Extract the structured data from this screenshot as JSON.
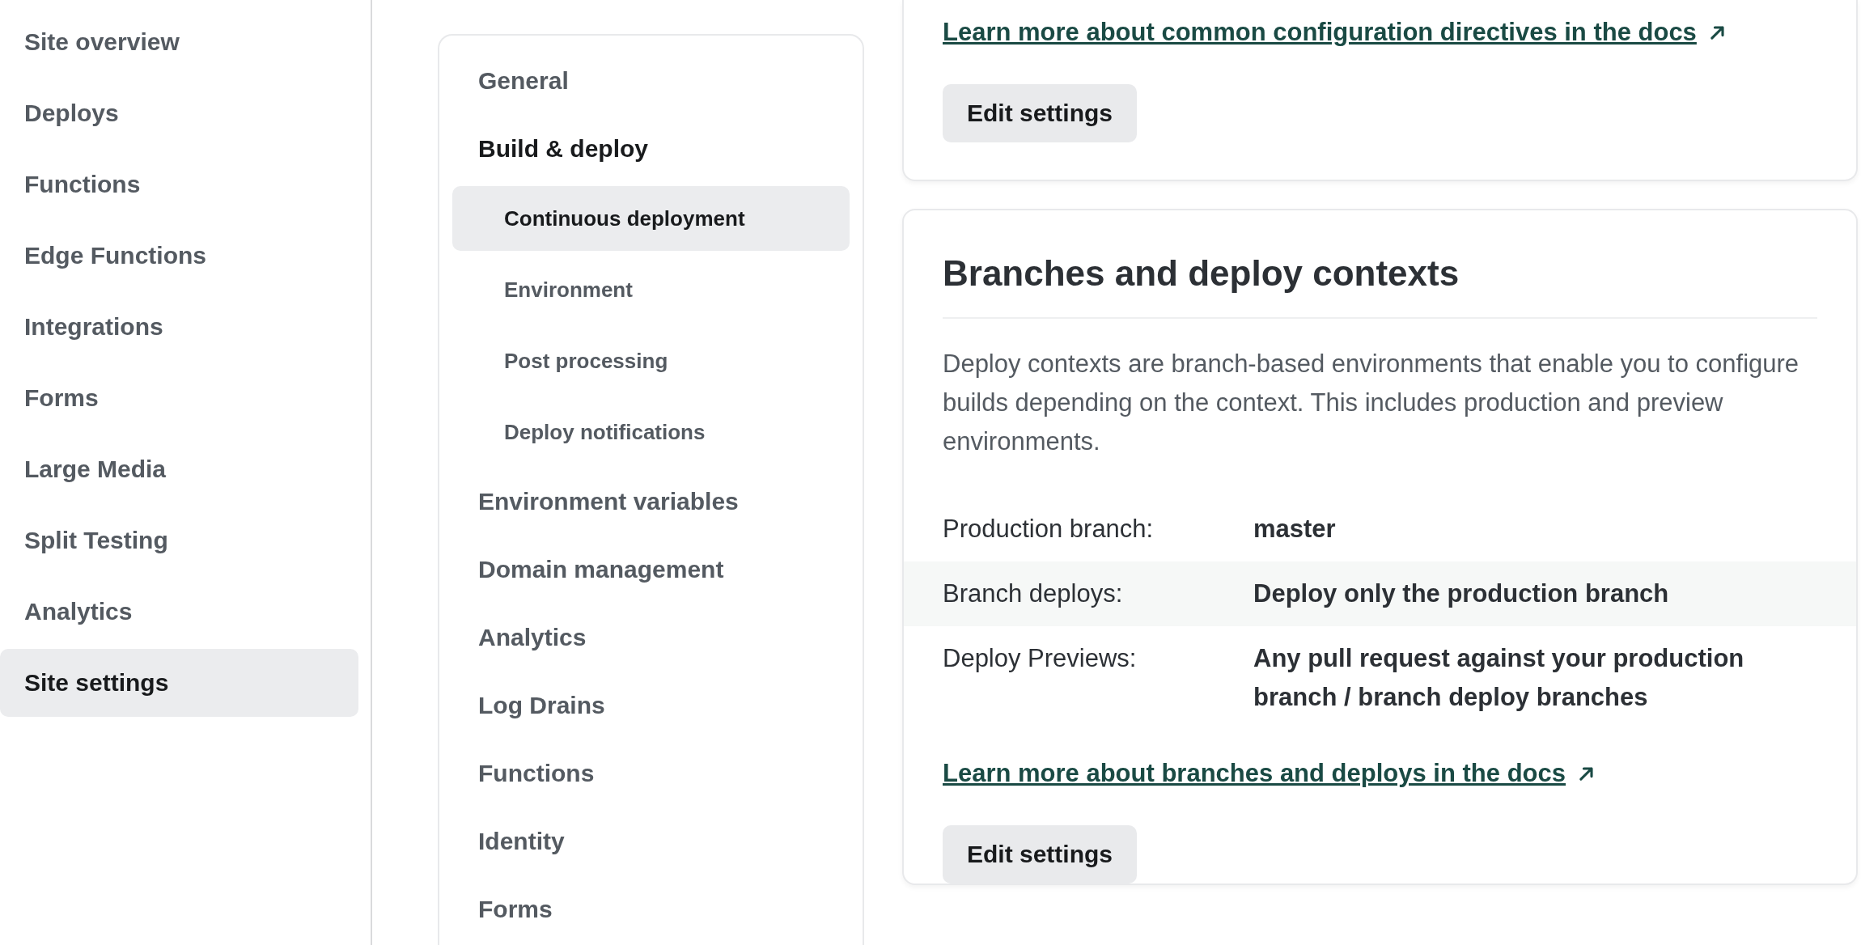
{
  "sidebar": {
    "items": [
      {
        "label": "Site overview",
        "selected": false
      },
      {
        "label": "Deploys",
        "selected": false
      },
      {
        "label": "Functions",
        "selected": false
      },
      {
        "label": "Edge Functions",
        "selected": false
      },
      {
        "label": "Integrations",
        "selected": false
      },
      {
        "label": "Forms",
        "selected": false
      },
      {
        "label": "Large Media",
        "selected": false
      },
      {
        "label": "Split Testing",
        "selected": false
      },
      {
        "label": "Analytics",
        "selected": false
      },
      {
        "label": "Site settings",
        "selected": true
      }
    ]
  },
  "settings_nav": {
    "items": [
      {
        "label": "General",
        "expanded": false
      },
      {
        "label": "Build & deploy",
        "expanded": true,
        "children": [
          {
            "label": "Continuous deployment",
            "selected": true
          },
          {
            "label": "Environment",
            "selected": false
          },
          {
            "label": "Post processing",
            "selected": false
          },
          {
            "label": "Deploy notifications",
            "selected": false
          }
        ]
      },
      {
        "label": "Environment variables",
        "expanded": false
      },
      {
        "label": "Domain management",
        "expanded": false
      },
      {
        "label": "Analytics",
        "expanded": false
      },
      {
        "label": "Log Drains",
        "expanded": false
      },
      {
        "label": "Functions",
        "expanded": false
      },
      {
        "label": "Identity",
        "expanded": false
      },
      {
        "label": "Forms",
        "expanded": false
      }
    ]
  },
  "cards": [
    {
      "link": "Learn more about common configuration directives in the docs",
      "button": "Edit settings"
    },
    {
      "title": "Branches and deploy contexts",
      "description": "Deploy contexts are branch-based environments that enable you to configure builds depending on the context. This includes production and preview environments.",
      "rows": [
        {
          "label": "Production branch:",
          "value": "master"
        },
        {
          "label": "Branch deploys:",
          "value": "Deploy only the production branch"
        },
        {
          "label": "Deploy Previews:",
          "value": "Any pull request against your production branch / branch deploy branches"
        }
      ],
      "link": "Learn more about branches and deploys in the docs",
      "button": "Edit settings"
    }
  ]
}
